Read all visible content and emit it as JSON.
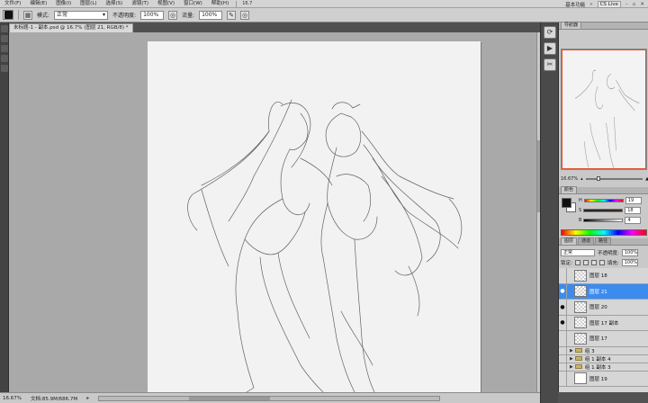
{
  "menubar": {
    "items": [
      "文件(F)",
      "编辑(E)",
      "图像(I)",
      "图层(L)",
      "选择(S)",
      "滤镜(T)",
      "视图(V)",
      "窗口(W)",
      "帮助(H)"
    ],
    "zoom": "16.7",
    "workspace": "基本功能",
    "cslive": "CS Live"
  },
  "options": {
    "mode_label": "模式:",
    "mode_value": "正常",
    "opacity_label": "不透明度:",
    "opacity_value": "100%",
    "flow_label": "流量:",
    "flow_value": "100%"
  },
  "document": {
    "tab_title": "未标题-1 - 副本.psd @ 16.7% (图层 21, RGB/8) *"
  },
  "status": {
    "zoom": "16.67%",
    "doc_size": "文档:85.9M/686.7M"
  },
  "navigator": {
    "tab": "导航器",
    "zoom": "16.67%"
  },
  "color_panel": {
    "tab": "颜色",
    "channels": [
      {
        "label": "H",
        "value": "19"
      },
      {
        "label": "S",
        "value": "18"
      },
      {
        "label": "B",
        "value": "4"
      }
    ]
  },
  "layers_panel": {
    "tabs": [
      "图层",
      "通道",
      "路径"
    ],
    "blend_mode": "正常",
    "opacity_label": "不透明度:",
    "opacity_value": "100%",
    "lock_label": "锁定:",
    "fill_label": "填充:",
    "fill_value": "100%",
    "layers": [
      {
        "name": "图层 18",
        "type": "layer",
        "visible": false,
        "selected": false
      },
      {
        "name": "图层 21",
        "type": "layer",
        "visible": true,
        "selected": true
      },
      {
        "name": "图层 20",
        "type": "layer",
        "visible": true,
        "selected": false
      },
      {
        "name": "图层 17 副本",
        "type": "layer",
        "visible": true,
        "selected": false
      },
      {
        "name": "图层 17",
        "type": "layer",
        "visible": false,
        "selected": false
      },
      {
        "name": "组 3",
        "type": "group",
        "visible": false,
        "selected": false
      },
      {
        "name": "组 1 副本 4",
        "type": "group",
        "visible": false,
        "selected": false
      },
      {
        "name": "组 1 副本 3",
        "type": "group",
        "visible": false,
        "selected": false
      },
      {
        "name": "图层 19",
        "type": "layer-white",
        "visible": false,
        "selected": false
      }
    ]
  }
}
